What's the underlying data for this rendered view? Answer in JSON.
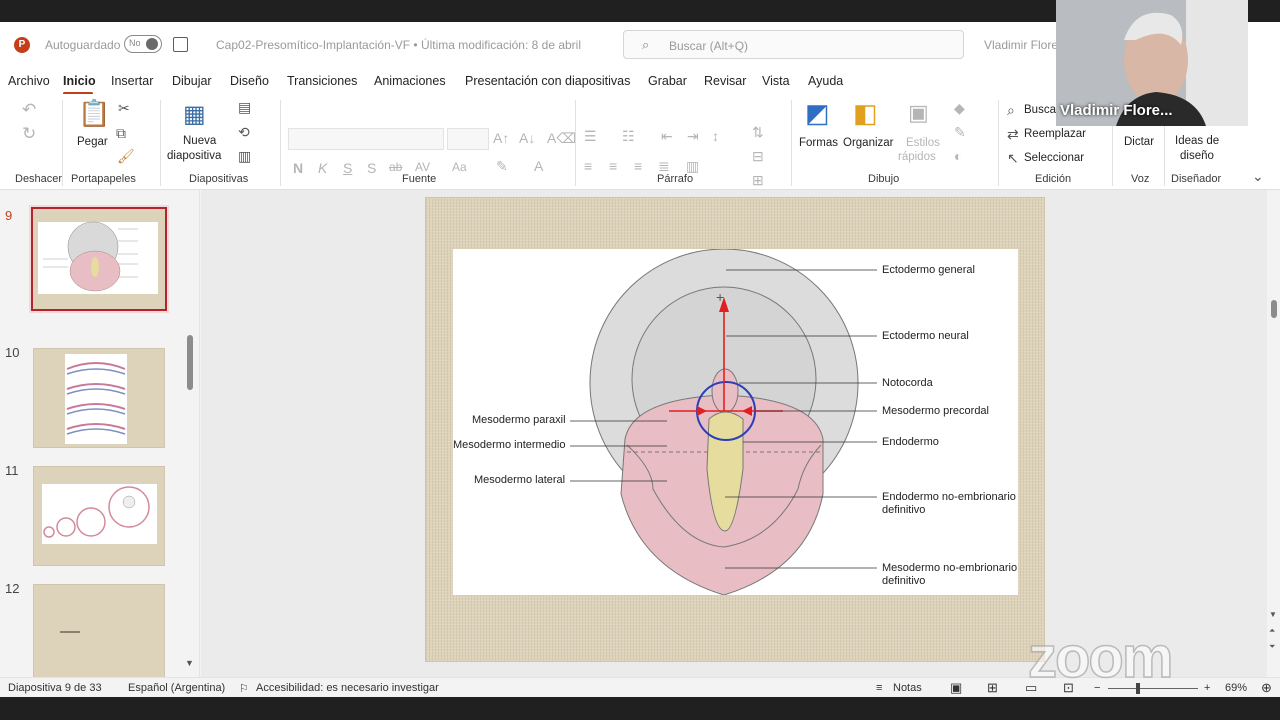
{
  "titlebar": {
    "autosave_label": "Autoguardado",
    "toggle_state": "No",
    "document_title": "Cap02-Presomítico-Implantación-VF • Última modificación: 8 de abril",
    "search_placeholder": "Buscar (Alt+Q)",
    "user_name": "Vladimir Flores"
  },
  "menu": [
    "Archivo",
    "Inicio",
    "Insertar",
    "Dibujar",
    "Diseño",
    "Transiciones",
    "Animaciones",
    "Presentación con diapositivas",
    "Grabar",
    "Revisar",
    "Vista",
    "Ayuda"
  ],
  "ribbon": {
    "groups": {
      "undo": "Deshacer",
      "clipboard": "Portapapeles",
      "slides": "Diapositivas",
      "font": "Fuente",
      "paragraph": "Párrafo",
      "drawing": "Dibujo",
      "editing": "Edición",
      "voice": "Voz",
      "designer": "Diseñador"
    },
    "paste": "Pegar",
    "new_slide_1": "Nueva",
    "new_slide_2": "diapositiva",
    "bold": "N",
    "italic": "K",
    "underline": "S",
    "shadow": "S",
    "strike": "ab",
    "spacing": "AV",
    "case": "Aa",
    "shapes": "Formas",
    "arrange": "Organizar",
    "quick_styles_1": "Estilos",
    "quick_styles_2": "rápidos",
    "find": "Buscar",
    "replace": "Reemplazar",
    "select": "Seleccionar",
    "dictate": "Dictar",
    "design_ideas_1": "Ideas de",
    "design_ideas_2": "diseño"
  },
  "thumbnails": [
    {
      "number": "9",
      "selected": true
    },
    {
      "number": "10",
      "selected": false
    },
    {
      "number": "11",
      "selected": false
    },
    {
      "number": "12",
      "selected": false
    }
  ],
  "slide": {
    "labels": {
      "ectodermo_general": "Ectodermo general",
      "ectodermo_neural": "Ectodermo neural",
      "notocorda": "Notocorda",
      "mesodermo_precordal": "Mesodermo precordal",
      "endodermo": "Endodermo",
      "endodermo_no_emb_1": "Endodermo no-embrionario",
      "endodermo_no_emb_2": "definitivo",
      "mesodermo_no_emb_1": "Mesodermo no-embrionario",
      "mesodermo_no_emb_2": "definitivo",
      "mesodermo_paraxil": "Mesodermo paraxil",
      "mesodermo_intermedio": "Mesodermo intermedio",
      "mesodermo_lateral": "Mesodermo lateral"
    },
    "colors": {
      "ectoderm": "#dcdcdc",
      "mesoderm": "#e8bec4",
      "endoderm": "#e6dc9e",
      "arrow": "#e02020",
      "circle": "#2b3fb8"
    }
  },
  "status": {
    "slide_info": "Diapositiva 9 de 33",
    "language": "Español (Argentina)",
    "accessibility": "Accesibilidad: es necesario investigar",
    "notes": "Notas",
    "zoom": "69%"
  },
  "video": {
    "participant_name": "Vladimir Flore...",
    "watermark": "zoom"
  }
}
